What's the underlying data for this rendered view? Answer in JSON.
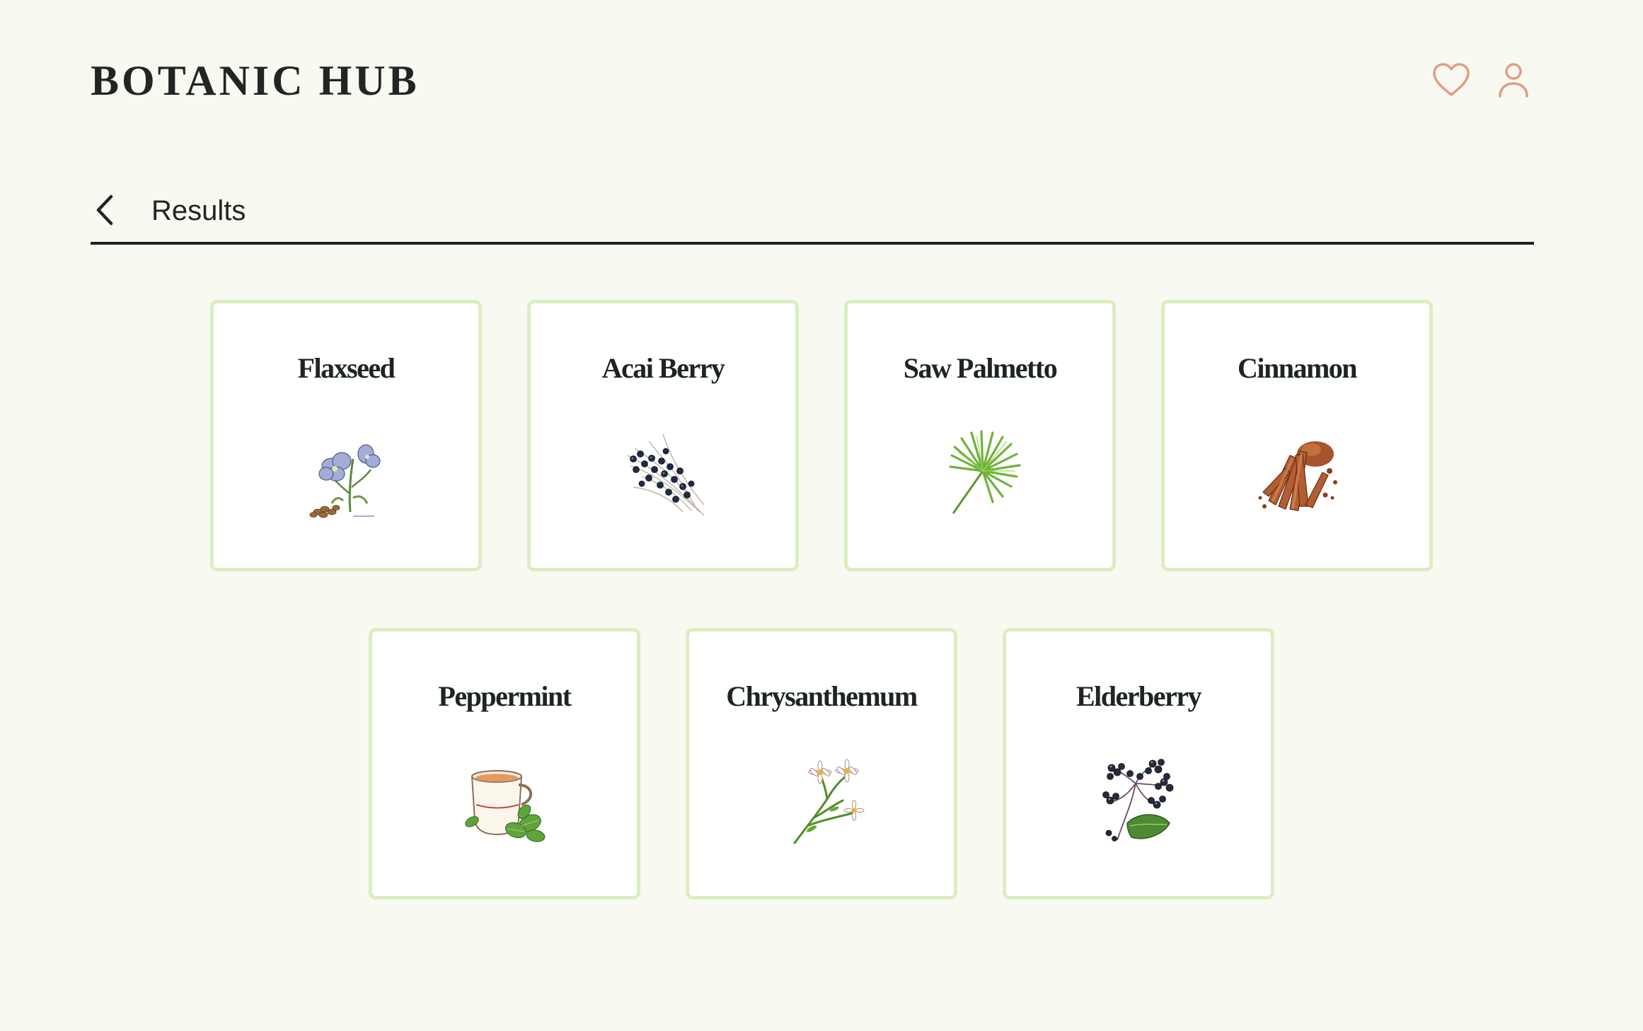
{
  "header": {
    "logo": "BOTANIC HUB",
    "icons": [
      "heart-icon",
      "user-icon"
    ],
    "accent_color": "#e59a88"
  },
  "results": {
    "title": "Results"
  },
  "cards": [
    {
      "name": "Flaxseed",
      "icon": "flaxseed-illustration"
    },
    {
      "name": "Acai Berry",
      "icon": "acai-berry-illustration"
    },
    {
      "name": "Saw Palmetto",
      "icon": "saw-palmetto-illustration"
    },
    {
      "name": "Cinnamon",
      "icon": "cinnamon-illustration"
    },
    {
      "name": "Peppermint",
      "icon": "peppermint-illustration"
    },
    {
      "name": "Chrysanthemum",
      "icon": "chrysanthemum-illustration"
    },
    {
      "name": "Elderberry",
      "icon": "elderberry-illustration"
    }
  ],
  "colors": {
    "background": "#f8faf1",
    "card_border": "#dcedc4",
    "text": "#1f2623"
  }
}
